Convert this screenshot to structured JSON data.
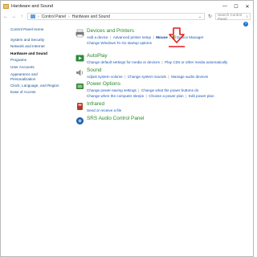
{
  "window": {
    "title": "Hardware and Sound",
    "controls": {
      "minimize": "—",
      "maximize": "☐",
      "close": "✕"
    }
  },
  "address": {
    "crumbs": [
      "Control Panel",
      "Hardware and Sound"
    ],
    "search_placeholder": "Search Control Panel"
  },
  "sidebar": {
    "items": [
      {
        "label": "Control Panel Home",
        "current": false
      },
      {
        "label": "System and Security",
        "current": false
      },
      {
        "label": "Network and Internet",
        "current": false
      },
      {
        "label": "Hardware and Sound",
        "current": true
      },
      {
        "label": "Programs",
        "current": false
      },
      {
        "label": "User Accounts",
        "current": false
      },
      {
        "label": "Appearance and Personalization",
        "current": false
      },
      {
        "label": "Clock, Language, and Region",
        "current": false
      },
      {
        "label": "Ease of Access",
        "current": false
      }
    ]
  },
  "categories": {
    "devices": {
      "title": "Devices and Printers",
      "links": [
        "Add a device",
        "Advanced printer setup",
        "Mouse",
        "Device Manager",
        "Change Windows To Go startup options"
      ]
    },
    "autoplay": {
      "title": "AutoPlay",
      "links": [
        "Change default settings for media or devices",
        "Play CDs or other media automatically"
      ]
    },
    "sound": {
      "title": "Sound",
      "links": [
        "Adjust system volume",
        "Change system sounds",
        "Manage audio devices"
      ]
    },
    "power": {
      "title": "Power Options",
      "links": [
        "Change power-saving settings",
        "Change what the power buttons do",
        "Change when the computer sleeps",
        "Choose a power plan",
        "Edit power plan"
      ]
    },
    "infrared": {
      "title": "Infrared",
      "links": [
        "Send or receive a file"
      ]
    },
    "srs": {
      "title": "SRS Audio Control Panel",
      "links": []
    }
  },
  "colors": {
    "link": "#1a56b8",
    "category_title": "#2a8a2a",
    "annotation": "#e01f1f"
  }
}
